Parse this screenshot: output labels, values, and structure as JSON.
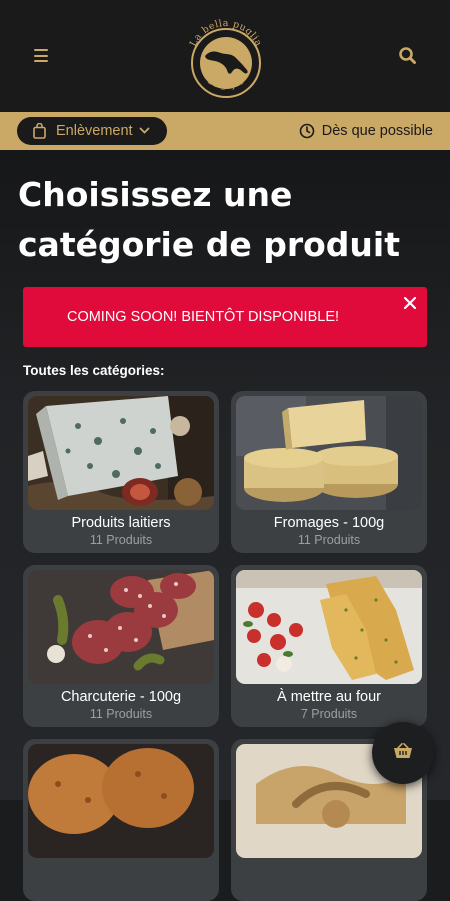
{
  "header": {
    "logo_text_top": "La bella puglia",
    "logo_text_bottom": "Belgique",
    "menu_icon": "hamburger-icon",
    "search_icon": "search-icon"
  },
  "order_bar": {
    "mode_label": "Enlèvement",
    "time_label": "Dès que possible"
  },
  "main": {
    "title": "Choisissez une catégorie de produit",
    "alert_text": "COMING SOON! BIENTÔT DISPONIBLE!",
    "section_label": "Toutes les catégories:"
  },
  "categories": [
    {
      "name": "Produits laitiers",
      "count": "11 Produits"
    },
    {
      "name": "Fromages - 100g",
      "count": "11 Produits"
    },
    {
      "name": "Charcuterie - 100g",
      "count": "11 Produits"
    },
    {
      "name": "À mettre au four",
      "count": "7 Produits"
    },
    {
      "name": "",
      "count": ""
    },
    {
      "name": "",
      "count": ""
    }
  ],
  "colors": {
    "gold": "#caa866",
    "alert_red": "#e00a3b",
    "card_bg": "#3c4043",
    "header_bg": "#1a1a1a"
  }
}
